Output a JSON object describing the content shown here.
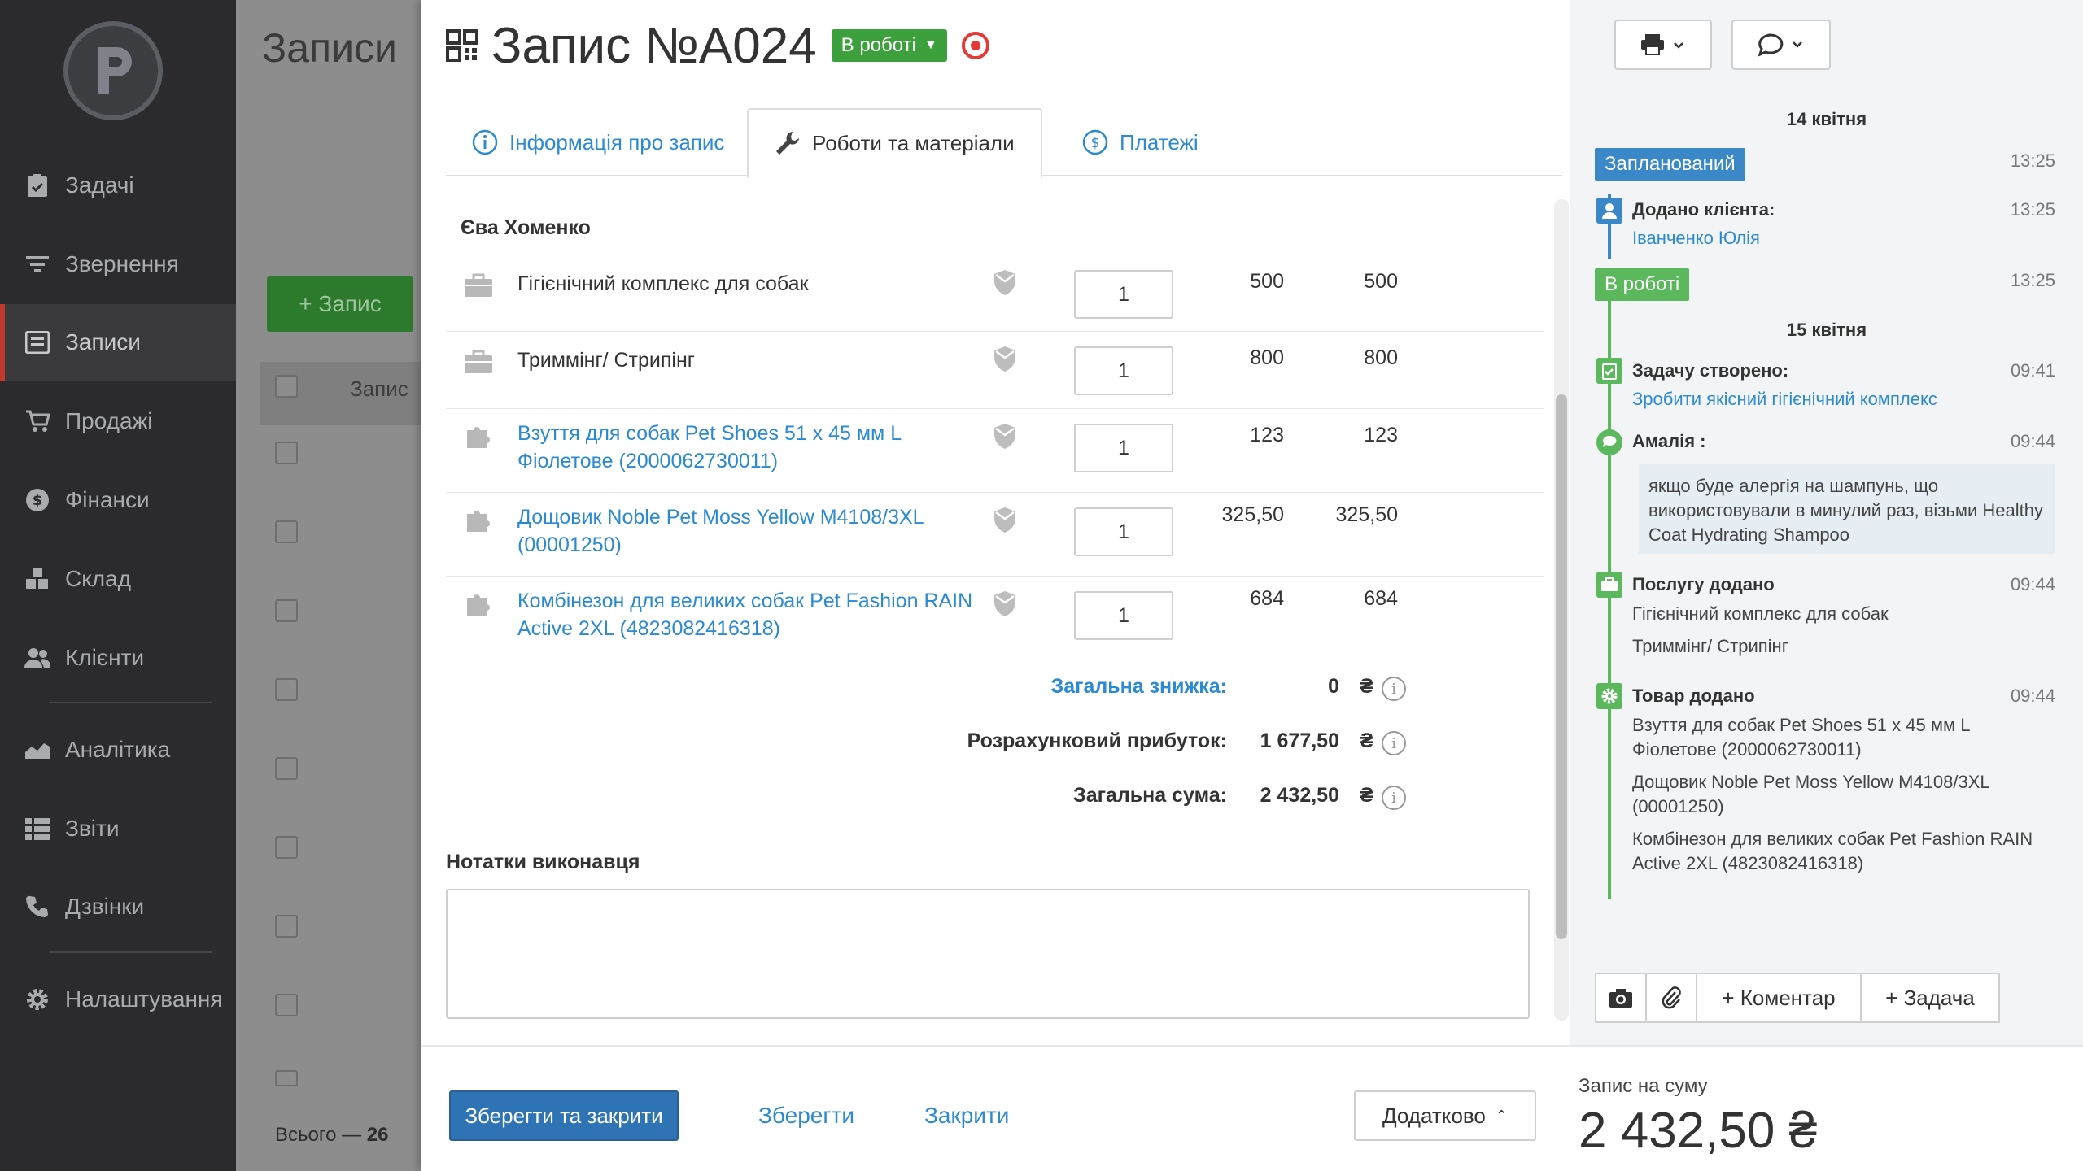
{
  "sidebar": {
    "items": [
      {
        "label": "Задачі",
        "icon": "clipboard-icon"
      },
      {
        "label": "Звернення",
        "icon": "filter-icon"
      },
      {
        "label": "Записи",
        "icon": "records-icon"
      },
      {
        "label": "Продажі",
        "icon": "cart-icon"
      },
      {
        "label": "Фінанси",
        "icon": "dollar-icon"
      },
      {
        "label": "Склад",
        "icon": "boxes-icon"
      },
      {
        "label": "Клієнти",
        "icon": "users-icon"
      },
      {
        "label": "Аналітика",
        "icon": "chart-icon"
      },
      {
        "label": "Звіти",
        "icon": "list-icon"
      },
      {
        "label": "Дзвінки",
        "icon": "phone-icon"
      },
      {
        "label": "Налаштування",
        "icon": "gear-icon"
      }
    ]
  },
  "background": {
    "title": "Записи",
    "add_label": "+ Запис",
    "col_header": "Запис",
    "total_prefix": "Всього —",
    "total_count": "26"
  },
  "record": {
    "title": "Запис №А024",
    "status": "В роботі"
  },
  "tabs": [
    {
      "label": "Інформація про запис"
    },
    {
      "label": "Роботи та матеріали"
    },
    {
      "label": "Платежі"
    }
  ],
  "client_name": "Єва Хоменко",
  "items": [
    {
      "name": "Гігієнічний комплекс для собак",
      "qty": "1",
      "price": "500",
      "total": "500",
      "link": false
    },
    {
      "name": "Триммінг/ Стрипінг",
      "qty": "1",
      "price": "800",
      "total": "800",
      "link": false
    },
    {
      "name": "Взуття для собак Pet Shoes 51 х 45 мм L Фіолетове (2000062730011)",
      "qty": "1",
      "price": "123",
      "total": "123",
      "link": true
    },
    {
      "name": "Дощовик Noble Pet Moss Yellow M4108/3XL (00001250)",
      "qty": "1",
      "price": "325,50",
      "total": "325,50",
      "link": true
    },
    {
      "name": "Комбінезон для великих собак Pet Fashion RAIN Active 2XL (4823082416318)",
      "qty": "1",
      "price": "684",
      "total": "684",
      "link": true
    }
  ],
  "summary": {
    "discount_label": "Загальна знижка:",
    "discount_value": "0",
    "profit_label": "Розрахунковий прибуток:",
    "profit_value": "1 677,50",
    "sum_label": "Загальна сума:",
    "sum_value": "2 432,50",
    "currency": "₴"
  },
  "notes_label": "Нотатки виконавця",
  "timeline": {
    "date1": "14 квітня",
    "badge_planned": "Запланований",
    "t1": "13:25",
    "client_added_head": "Додано клієнта:",
    "client_added_time": "13:25",
    "client_added_name": "Іванченко Юлія",
    "badge_inwork": "В роботі",
    "t2": "13:25",
    "date2": "15 квітня",
    "task_head": "Задачу створено:",
    "task_time": "09:41",
    "task_link": "Зробити якісний гігієнічний комплекс",
    "comment_author": "Амалія :",
    "comment_time": "09:44",
    "comment_text": "якщо буде алергія на шампунь, що використовували в минулий раз, візьми Healthy Coat Hydrating Shampoo",
    "service_head": "Послугу додано",
    "service_time": "09:44",
    "service_1": "Гігієнічний комплекс для собак",
    "service_2": "Триммінг/ Стрипінг",
    "goods_head": "Товар додано",
    "goods_time": "09:44",
    "goods_1": "Взуття для собак Pet Shoes 51 х 45 мм L Фіолетове (2000062730011)",
    "goods_2": "Дощовик Noble Pet Moss Yellow M4108/3XL (00001250)",
    "goods_3": "Комбінезон для великих собак Pet Fashion RAIN Active 2XL (4823082416318)",
    "comment_btn": "+ Коментар",
    "task_btn": "+ Задача"
  },
  "footer": {
    "save_close": "Зберегти та закрити",
    "save": "Зберегти",
    "close": "Закрити",
    "more": "Додатково",
    "total_label": "Запис на суму",
    "total_value": "2 432,50 ₴"
  },
  "colors": {
    "accent": "#2b8ad1",
    "status_green": "#3ca13c",
    "planned_blue": "#3b88c8",
    "primary": "#2e74b5"
  }
}
